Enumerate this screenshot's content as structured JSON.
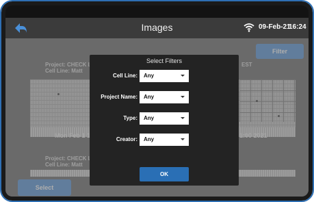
{
  "header": {
    "title": "Images",
    "date": "09-Feb-21",
    "time": "16:24",
    "back_icon": "back-arrow-icon",
    "wifi_icon": "wifi-icon"
  },
  "toolbar": {
    "filter_label": "Filter",
    "select_label": "Select"
  },
  "cards": [
    {
      "project_line": "Project: CHECK L",
      "cell_line": "Cell Line: Matt",
      "right_suffix": "EST",
      "timestamp_left": "Mon Feb 1 1",
      "timestamp_right": "1:00 2021"
    },
    {
      "project_line": "Project: CHECK L",
      "cell_line": "Cell Line: Matt"
    }
  ],
  "dialog": {
    "title": "Select Filters",
    "fields": [
      {
        "label": "Cell Line:",
        "value": "Any"
      },
      {
        "label": "Project Name:",
        "value": "Any"
      },
      {
        "label": "Type:",
        "value": "Any"
      },
      {
        "label": "Creator:",
        "value": "Any"
      }
    ],
    "ok_label": "OK"
  },
  "colors": {
    "accent_blue": "#2a6fb5",
    "light_blue_button": "#8fb8e6",
    "header_bg": "#3b3b3b",
    "dialog_bg": "#232323"
  }
}
